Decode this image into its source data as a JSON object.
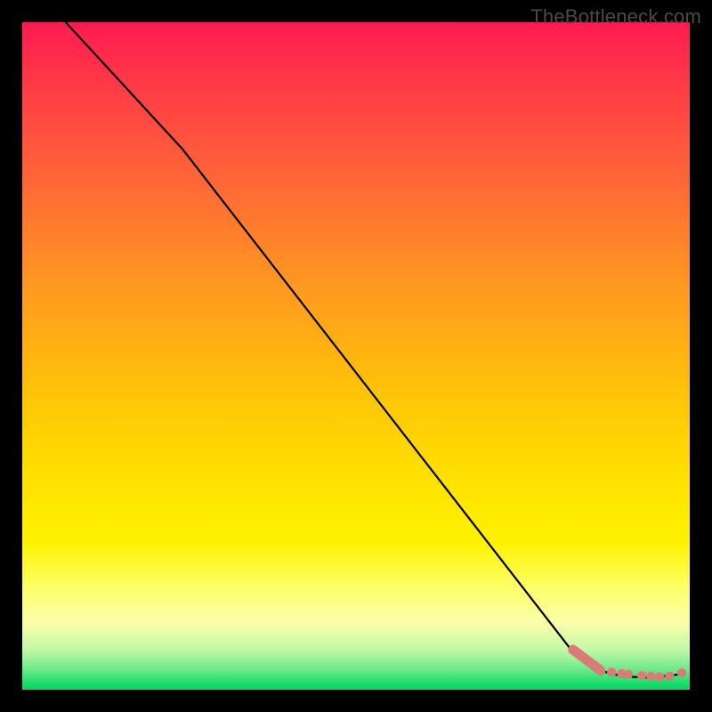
{
  "attribution": "TheBottleneck.com",
  "chart_data": {
    "type": "line",
    "title": "",
    "xlabel": "",
    "ylabel": "",
    "xlim": [
      0,
      100
    ],
    "ylim": [
      0,
      100
    ],
    "series": [
      {
        "name": "curve",
        "x": [
          6.5,
          24,
          83,
          86,
          90,
          94,
          98.5
        ],
        "y": [
          100,
          81,
          5,
          3,
          2,
          1.8,
          2.3
        ]
      }
    ],
    "markers": {
      "name": "highlight-cluster",
      "segment": {
        "x": [
          82.5,
          86.5
        ],
        "y": [
          6,
          3
        ]
      },
      "points_x": [
        86.7,
        88.3,
        89.8,
        90.8,
        92.8,
        94.2,
        95.5,
        97.0,
        98.8
      ],
      "points_y": [
        2.8,
        2.6,
        2.4,
        2.3,
        2.1,
        2.0,
        1.9,
        2.0,
        2.5
      ]
    },
    "gradient_bands": [
      {
        "pos": 0,
        "color": "#ff1a52"
      },
      {
        "pos": 55,
        "color": "#ffc208"
      },
      {
        "pos": 78,
        "color": "#fff200"
      },
      {
        "pos": 100,
        "color": "#00d563"
      }
    ]
  }
}
